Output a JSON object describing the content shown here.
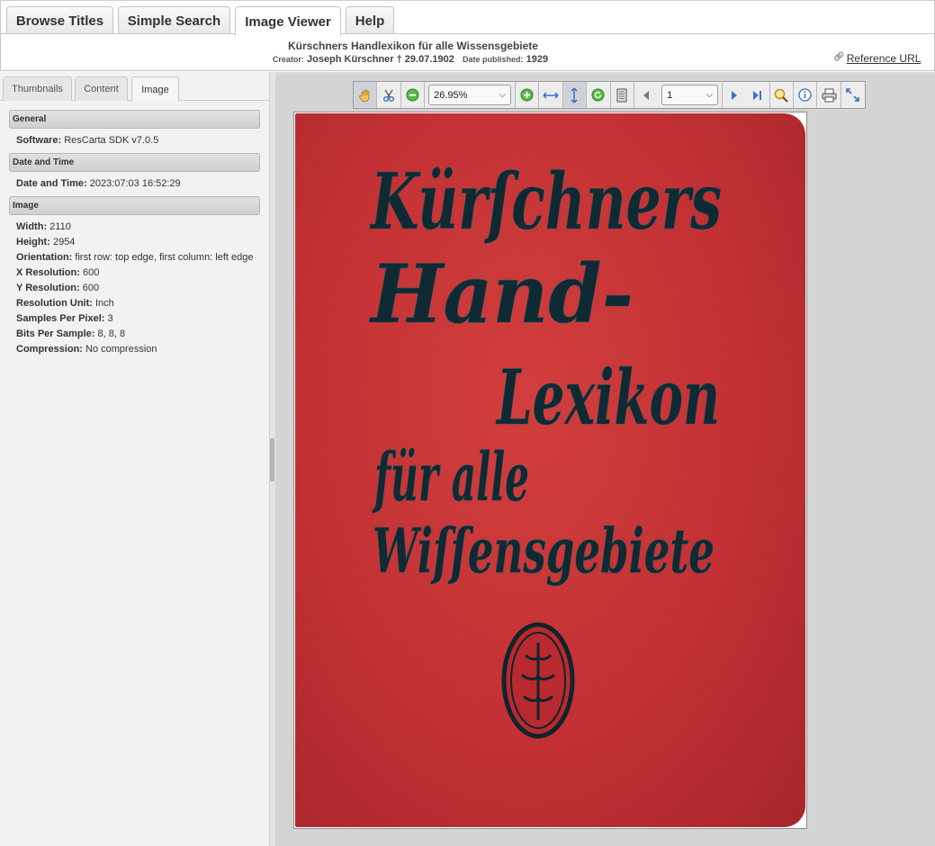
{
  "top_tabs": [
    {
      "label": "Browse Titles"
    },
    {
      "label": "Simple Search"
    },
    {
      "label": "Image Viewer"
    },
    {
      "label": "Help"
    }
  ],
  "header": {
    "title": "Kürschners Handlexikon für alle Wissensgebiete",
    "creator_label": "Creator:",
    "creator": "Joseph Kürschner † 29.07.1902",
    "date_label": "Date published:",
    "date": "1929",
    "reference_url": "Reference URL"
  },
  "side_tabs": [
    {
      "label": "Thumbnails"
    },
    {
      "label": "Content"
    },
    {
      "label": "Image"
    }
  ],
  "metadata": {
    "general": {
      "heading": "General",
      "software_label": "Software:",
      "software": "ResCarta SDK v7.0.5"
    },
    "datetime": {
      "heading": "Date and Time",
      "label": "Date and Time:",
      "value": "2023:07:03 16:52:29"
    },
    "image": {
      "heading": "Image",
      "props": [
        {
          "label": "Width:",
          "value": "2110"
        },
        {
          "label": "Height:",
          "value": "2954"
        },
        {
          "label": "Orientation:",
          "value": "first row: top edge, first column: left edge"
        },
        {
          "label": "X Resolution:",
          "value": "600"
        },
        {
          "label": "Y Resolution:",
          "value": "600"
        },
        {
          "label": "Resolution Unit:",
          "value": "Inch"
        },
        {
          "label": "Samples Per Pixel:",
          "value": "3"
        },
        {
          "label": "Bits Per Sample:",
          "value": "8, 8, 8"
        },
        {
          "label": "Compression:",
          "value": "No compression"
        }
      ]
    }
  },
  "toolbar": {
    "zoom": "26.95%",
    "page": "1"
  },
  "cover": {
    "lines": [
      "Kürſchners",
      "Hand-",
      "Lexikon",
      "für alle",
      "Wiſſensgebiete"
    ],
    "colors": {
      "cloth": "#c83236",
      "ink": "#0f2a33"
    }
  }
}
